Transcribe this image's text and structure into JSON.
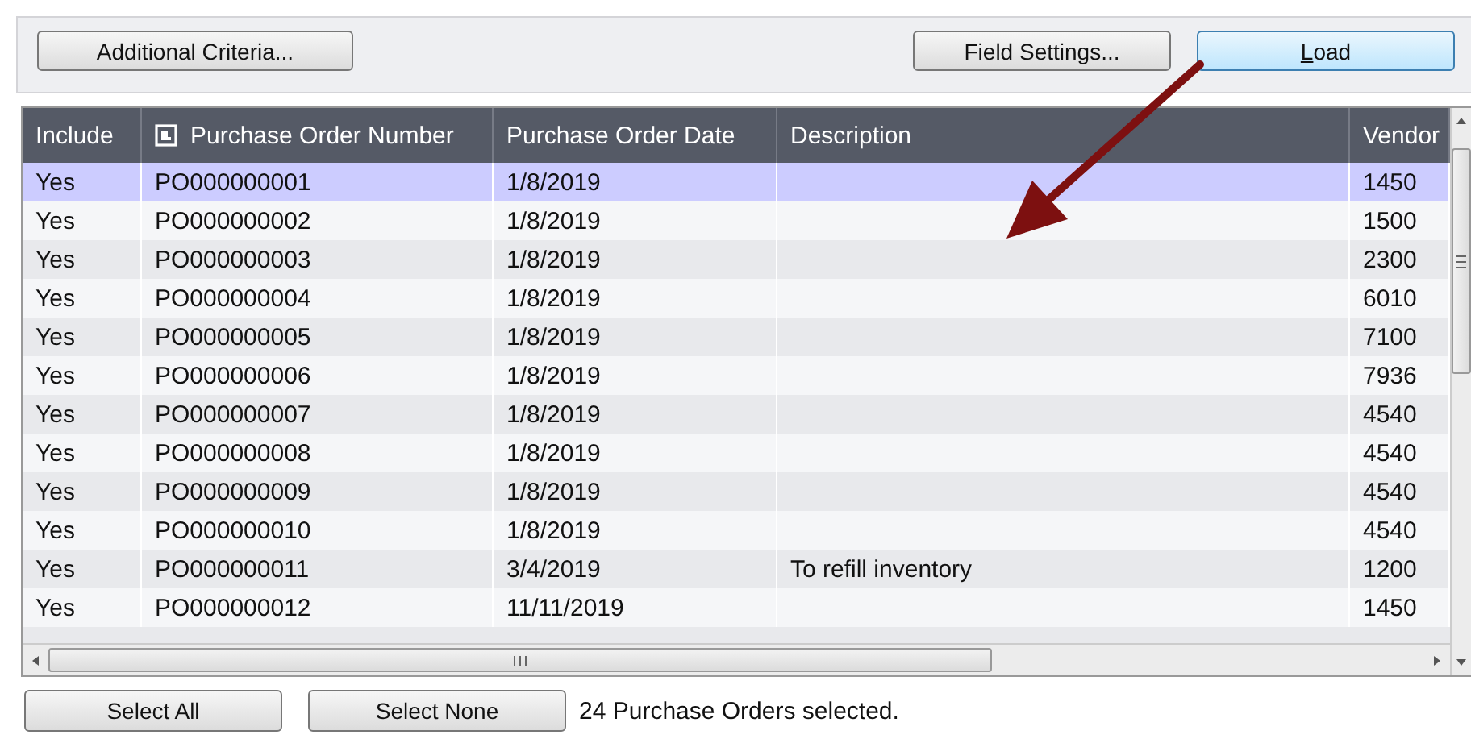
{
  "toolbar": {
    "buttons": [
      {
        "label": "Additional Criteria...",
        "kind": "plain"
      },
      {
        "label": "Field Settings...",
        "kind": "plain"
      },
      {
        "label": "Load",
        "kind": "default",
        "mnemonic_underlined": true
      }
    ]
  },
  "table": {
    "columns": [
      {
        "label": "Include",
        "icon": false
      },
      {
        "label": "Purchase Order Number",
        "icon": true
      },
      {
        "label": "Purchase Order Date",
        "icon": false
      },
      {
        "label": "Description",
        "icon": false
      },
      {
        "label": "Vendor",
        "icon": false
      }
    ],
    "rows": [
      {
        "cells": [
          "Yes",
          "PO000000001",
          "1/8/2019",
          "",
          "1450"
        ],
        "selected": true
      },
      {
        "cells": [
          "Yes",
          "PO000000002",
          "1/8/2019",
          "",
          "1500"
        ],
        "selected": false
      },
      {
        "cells": [
          "Yes",
          "PO000000003",
          "1/8/2019",
          "",
          "2300"
        ],
        "selected": false
      },
      {
        "cells": [
          "Yes",
          "PO000000004",
          "1/8/2019",
          "",
          "6010"
        ],
        "selected": false
      },
      {
        "cells": [
          "Yes",
          "PO000000005",
          "1/8/2019",
          "",
          "7100"
        ],
        "selected": false
      },
      {
        "cells": [
          "Yes",
          "PO000000006",
          "1/8/2019",
          "",
          "7936"
        ],
        "selected": false
      },
      {
        "cells": [
          "Yes",
          "PO000000007",
          "1/8/2019",
          "",
          "4540"
        ],
        "selected": false
      },
      {
        "cells": [
          "Yes",
          "PO000000008",
          "1/8/2019",
          "",
          "4540"
        ],
        "selected": false
      },
      {
        "cells": [
          "Yes",
          "PO000000009",
          "1/8/2019",
          "",
          "4540"
        ],
        "selected": false
      },
      {
        "cells": [
          "Yes",
          "PO000000010",
          "1/8/2019",
          "",
          "4540"
        ],
        "selected": false
      },
      {
        "cells": [
          "Yes",
          "PO000000011",
          "3/4/2019",
          "To refill inventory",
          "1200"
        ],
        "selected": false
      },
      {
        "cells": [
          "Yes",
          "PO000000012",
          "11/11/2019",
          "",
          "1450"
        ],
        "selected": false
      }
    ]
  },
  "footer": {
    "buttons": [
      {
        "label": "Select All"
      },
      {
        "label": "Select None"
      }
    ],
    "status": "24 Purchase Orders selected."
  }
}
